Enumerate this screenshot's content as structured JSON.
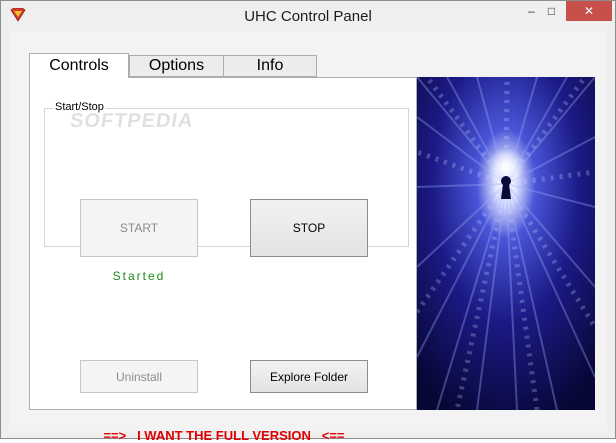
{
  "window": {
    "title": "UHC Control Panel",
    "icon": "superman-shield-icon",
    "controls": {
      "minimize": "–",
      "maximize": "□",
      "close": "✕"
    }
  },
  "tabs": [
    {
      "label": "Controls",
      "selected": true
    },
    {
      "label": "Options",
      "selected": false
    },
    {
      "label": "Info",
      "selected": false
    }
  ],
  "controls_tab": {
    "group_label": "Start/Stop",
    "start_label": "START",
    "start_enabled": false,
    "stop_label": "STOP",
    "status_text": "Started",
    "uninstall_label": "Uninstall",
    "uninstall_enabled": false,
    "explore_label": "Explore Folder",
    "full_version_text": "==>   I WANT THE FULL VERSION   <=="
  },
  "watermark": "SOFTPEDIA",
  "colors": {
    "status_green": "#1a8c1a",
    "full_version_red": "#e00000",
    "close_button": "#c7504b",
    "banner_glow": "#ffffff",
    "banner_deep": "#0b0b4a"
  },
  "banner_image": "binary-tunnel-keyhole"
}
